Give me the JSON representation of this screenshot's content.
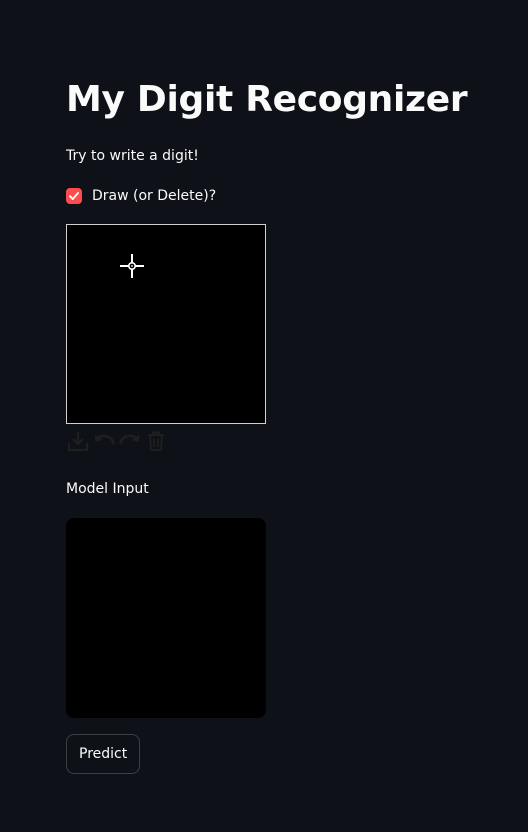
{
  "app": {
    "title": "My Digit Recognizer",
    "instruction": "Try to write a digit!"
  },
  "draw_toggle": {
    "label": "Draw (or Delete)?",
    "checked": true,
    "color": "#ff4b4b"
  },
  "drawing_canvas": {
    "background": "#000000",
    "cursor_icon": "crosshair-icon",
    "tools": [
      "download-icon",
      "undo-icon",
      "redo-icon",
      "trash-icon"
    ]
  },
  "model_input": {
    "label": "Model Input"
  },
  "actions": {
    "predict_label": "Predict"
  },
  "theme": {
    "background": "#0e1117",
    "text": "#fafafa",
    "accent": "#ff4b4b"
  }
}
